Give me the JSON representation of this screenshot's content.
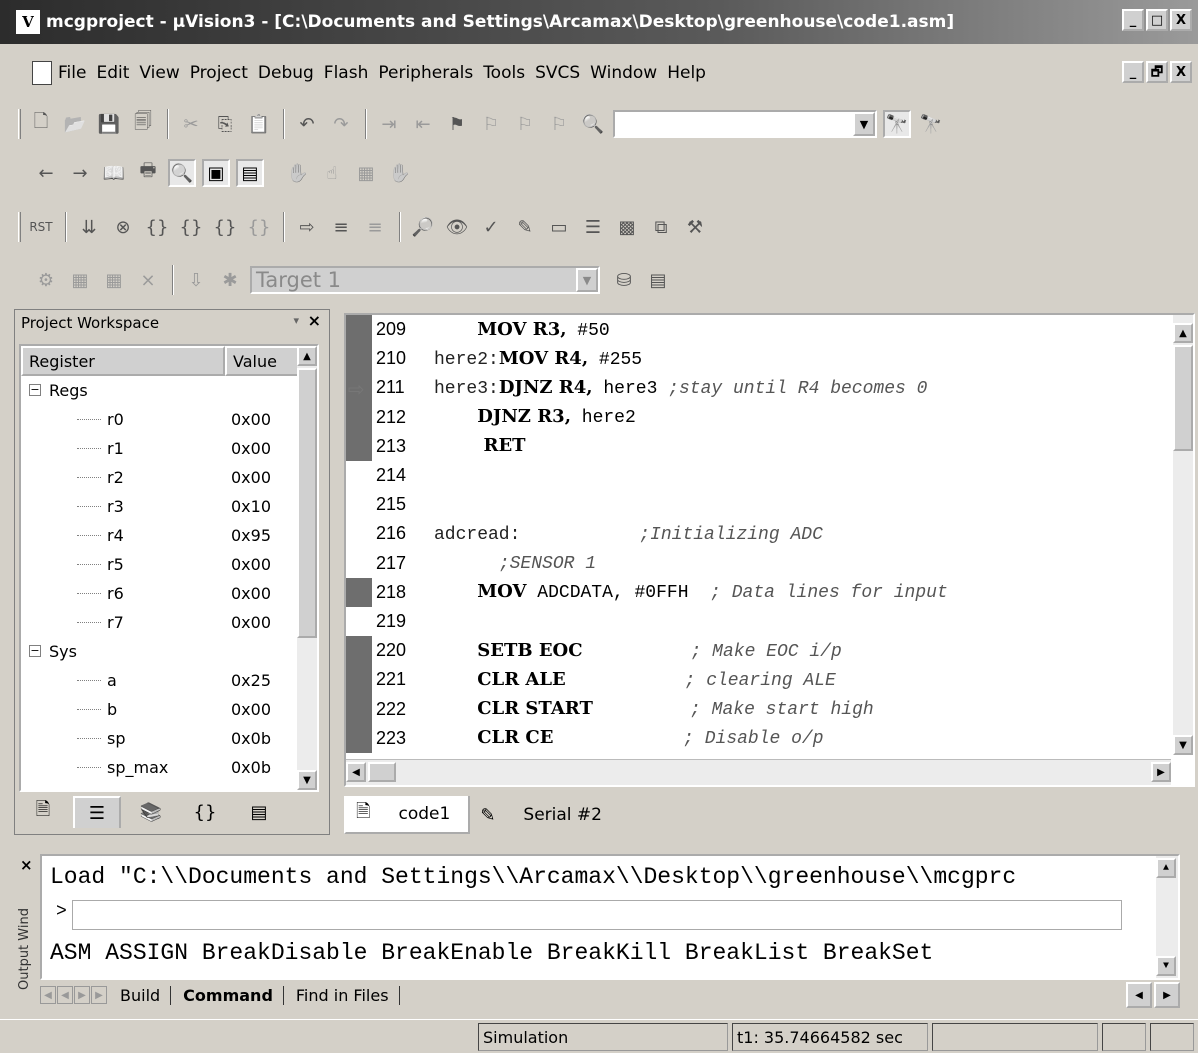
{
  "window": {
    "title": "mcgproject  - µVision3 - [C:\\Documents and Settings\\Arcamax\\Desktop\\greenhouse\\code1.asm]",
    "app_icon_label": "V",
    "caption_buttons": [
      "_",
      "□",
      "X"
    ],
    "mdi_buttons": [
      "_",
      "🗗",
      "X"
    ]
  },
  "menu": {
    "items": [
      "File",
      "Edit",
      "View",
      "Project",
      "Debug",
      "Flash",
      "Peripherals",
      "Tools",
      "SVCS",
      "Window",
      "Help"
    ]
  },
  "toolbar": {
    "find_combo_value": "",
    "target_combo_value": "Target 1"
  },
  "workspace": {
    "title": "Project Workspace",
    "col_register": "Register",
    "col_value": "Value",
    "groups": [
      {
        "name": "Regs",
        "expanded": true,
        "items": [
          {
            "name": "r0",
            "value": "0x00"
          },
          {
            "name": "r1",
            "value": "0x00"
          },
          {
            "name": "r2",
            "value": "0x00"
          },
          {
            "name": "r3",
            "value": "0x10"
          },
          {
            "name": "r4",
            "value": "0x95"
          },
          {
            "name": "r5",
            "value": "0x00"
          },
          {
            "name": "r6",
            "value": "0x00"
          },
          {
            "name": "r7",
            "value": "0x00"
          }
        ]
      },
      {
        "name": "Sys",
        "expanded": true,
        "items": [
          {
            "name": "a",
            "value": "0x25"
          },
          {
            "name": "b",
            "value": "0x00"
          },
          {
            "name": "sp",
            "value": "0x0b"
          },
          {
            "name": "sp_max",
            "value": "0x0b"
          }
        ]
      }
    ]
  },
  "editor": {
    "current_line": 211,
    "lines": [
      {
        "n": "209",
        "label": "",
        "instr": "MOV R3,",
        "arg": " #50",
        "comment": "",
        "exec": true
      },
      {
        "n": "210",
        "label": "here2:",
        "instr": "MOV R4,",
        "arg": " #255",
        "comment": "",
        "exec": true
      },
      {
        "n": "211",
        "label": "here3:",
        "instr": "DJNZ R4,",
        "arg": " here3",
        "comment": " ;stay until R4 becomes 0",
        "exec": true
      },
      {
        "n": "212",
        "label": "",
        "instr": "DJNZ R3,",
        "arg": " here2",
        "comment": "",
        "exec": true
      },
      {
        "n": "213",
        "label": "",
        "instr": " RET",
        "arg": "",
        "comment": "",
        "exec": true
      },
      {
        "n": "214",
        "label": "",
        "instr": "",
        "arg": "",
        "comment": "",
        "exec": false
      },
      {
        "n": "215",
        "label": "",
        "instr": "",
        "arg": "",
        "comment": "",
        "exec": false
      },
      {
        "n": "216",
        "label": "adcread:",
        "instr": "",
        "arg": "",
        "comment": "           ;Initializing ADC",
        "exec": false
      },
      {
        "n": "217",
        "label": "",
        "instr": "",
        "arg": "",
        "comment": "  ;SENSOR 1",
        "exec": false
      },
      {
        "n": "218",
        "label": "",
        "instr": "MOV",
        "arg": " ADCDATA, #0FFH",
        "comment": "  ; Data lines for input",
        "exec": true
      },
      {
        "n": "219",
        "label": "",
        "instr": "",
        "arg": "",
        "comment": "",
        "exec": false
      },
      {
        "n": "220",
        "label": "",
        "instr": "SETB EOC",
        "arg": "",
        "comment": "          ; Make EOC i/p",
        "exec": true
      },
      {
        "n": "221",
        "label": "",
        "instr": "CLR ALE",
        "arg": "",
        "comment": "           ; clearing ALE",
        "exec": true
      },
      {
        "n": "222",
        "label": "",
        "instr": "CLR START",
        "arg": "",
        "comment": "         ; Make start high",
        "exec": true
      },
      {
        "n": "223",
        "label": "",
        "instr": "CLR CE",
        "arg": "",
        "comment": "            ; Disable o/p",
        "exec": true
      }
    ],
    "tabs": [
      {
        "label": "code1",
        "active": true
      },
      {
        "label": "Serial #2",
        "active": false
      }
    ]
  },
  "output": {
    "side_title": "Output Wind",
    "load_line": "Load \"C:\\\\Documents and Settings\\\\Arcamax\\\\Desktop\\\\greenhouse\\\\mcgprc",
    "prompt": ">",
    "commands_line": "ASM ASSIGN BreakDisable BreakEnable BreakKill BreakList BreakSet",
    "tabs": [
      "Build",
      "Command",
      "Find in Files"
    ],
    "active_tab": "Command"
  },
  "status": {
    "mode": "Simulation",
    "time": "t1: 35.74664582 sec"
  }
}
